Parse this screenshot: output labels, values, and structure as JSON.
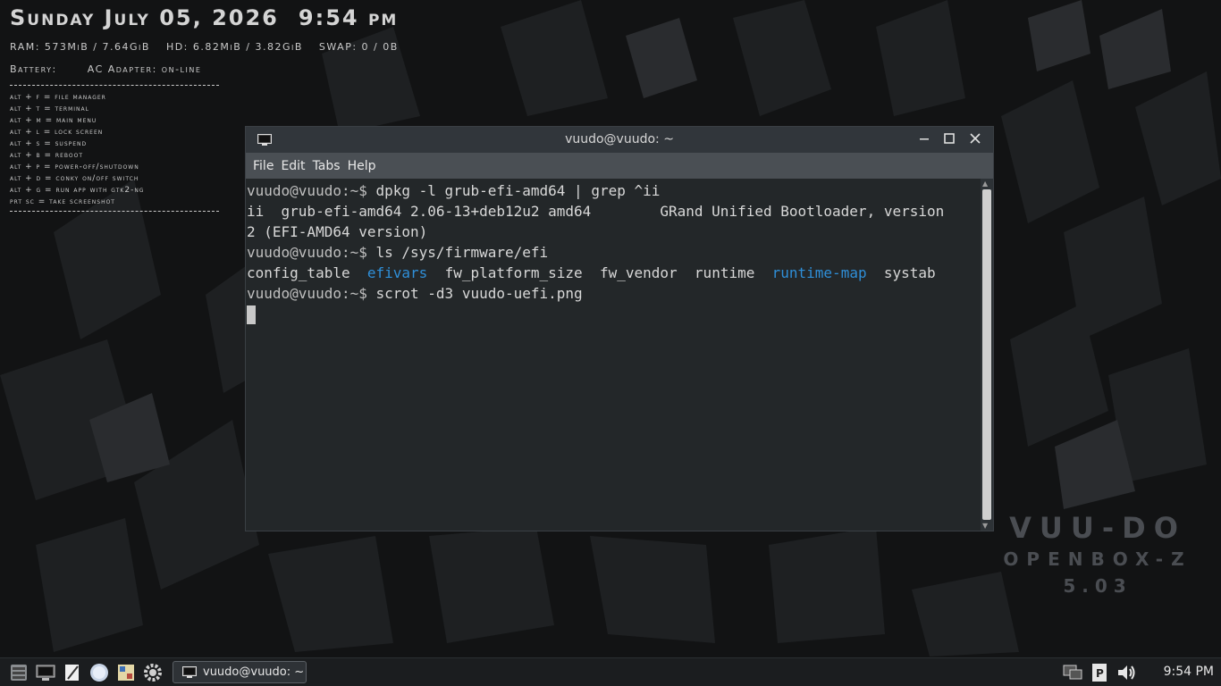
{
  "conky": {
    "date": "Sunday July 05, 2026",
    "time": "9:54 pm",
    "ram": "RAM: 573MiB / 7.64GiB",
    "hd": "HD: 6.82MiB / 3.82GiB",
    "swap": "SWAP: 0 / 0B",
    "battery": "Battery:",
    "ac_adapter": "AC Adapter:  on-line",
    "shortcuts": [
      "alt + f = file manager",
      "alt + t = terminal",
      "alt + m = main menu",
      "alt + l = lock screen",
      "alt + s = suspend",
      "alt + b = reboot",
      "alt + p = power-off/shutdown",
      "alt + d = conky on/off switch",
      "alt + g = run app with gtk2-ng",
      "prt sc  = take screenshot"
    ]
  },
  "branding": {
    "line1": "VUU-DO",
    "line2": "OPENBOX-Z",
    "line3": "5.03"
  },
  "window": {
    "title": "vuudo@vuudo: ~",
    "menu": [
      "File",
      "Edit",
      "Tabs",
      "Help"
    ],
    "terminal": {
      "prompt": "vuudo@vuudo:~$",
      "cmd1": " dpkg -l grub-efi-amd64 | grep ^ii",
      "out1": "ii  grub-efi-amd64 2.06-13+deb12u2 amd64        GRand Unified Bootloader, version",
      "out2": "2 (EFI-AMD64 version)",
      "cmd2": " ls /sys/firmware/efi",
      "ls": {
        "config_table": "config_table",
        "efivars": "efivars",
        "fw_platform_size": "fw_platform_size",
        "fw_vendor": "fw_vendor",
        "runtime": "runtime",
        "runtime_map": "runtime-map",
        "systab": "systab"
      },
      "cmd3": " scrot -d3 vuudo-uefi.png"
    }
  },
  "taskbar": {
    "task_label": "vuudo@vuudo: ~",
    "clock": "9:54 PM"
  },
  "colors": {
    "dir_blue": "#2f8fd8",
    "terminal_bg": "#232729",
    "titlebar": "#31363b",
    "menubar": "#4a4f54"
  }
}
